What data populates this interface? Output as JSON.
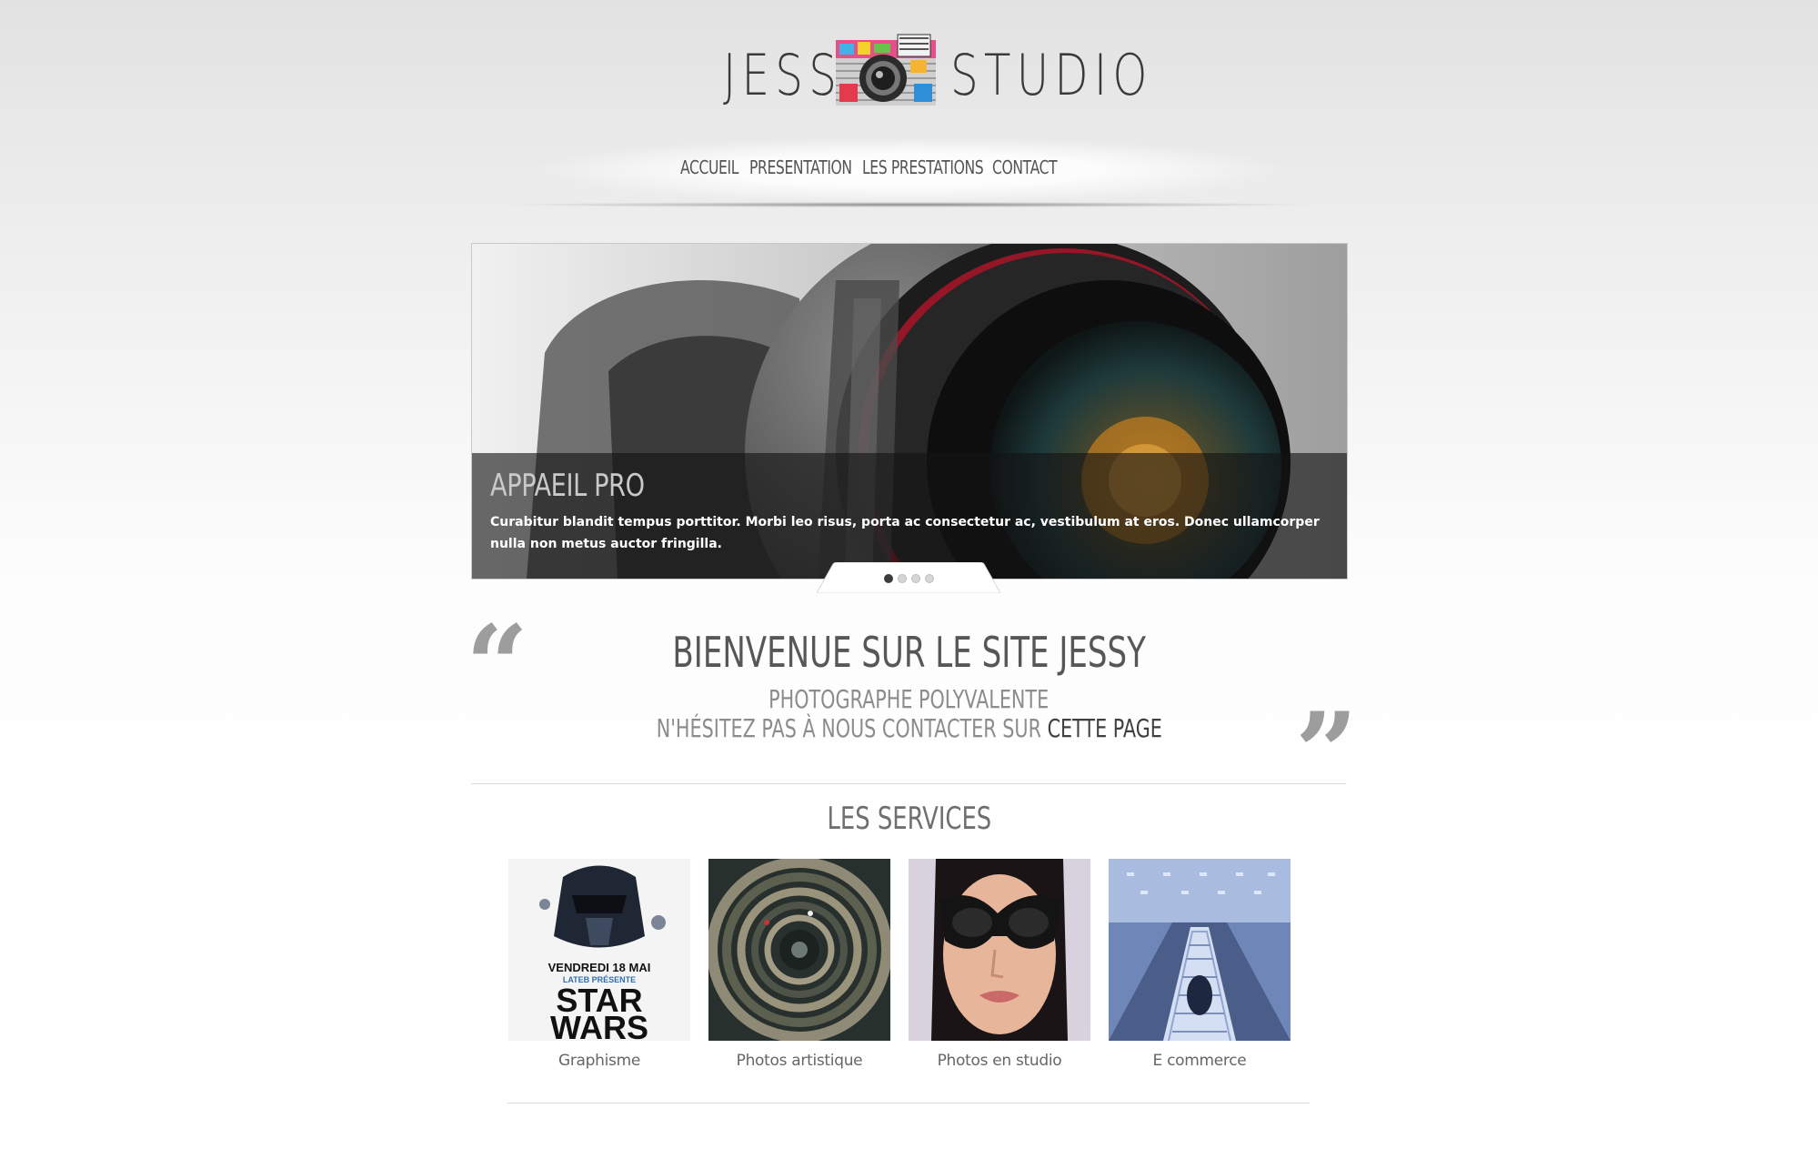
{
  "logo": {
    "left": "JESS",
    "right": "STUDIO",
    "icon": "retro-camera-icon"
  },
  "nav": {
    "items": [
      "ACCUEIL",
      "PRESENTATION",
      "LES PRESTATIONS",
      "CONTACT"
    ]
  },
  "slider": {
    "title": "APPAEIL PRO",
    "text": "Curabitur blandit tempus porttitor. Morbi leo risus, porta ac consectetur ac, vestibulum at eros. Donec ullamcorper nulla non metus auctor fringilla.",
    "slides_count": 4,
    "active_index": 0
  },
  "welcome": {
    "title": "BIENVENUE SUR LE SITE JESSY",
    "subtitle": "PHOTOGRAPHE POLYVALENTE",
    "contact_prefix": "N'HÉSITEZ PAS À NOUS CONTACTER SUR",
    "contact_link": "CETTE PAGE"
  },
  "services": {
    "title": "LES SERVICES",
    "items": [
      {
        "label": "Graphisme",
        "poster_line1": "VENDREDI 18 MAI",
        "poster_line2": "LATEB PRÉSENTE",
        "poster_line3": "STAR",
        "poster_line4": "WARS"
      },
      {
        "label": "Photos artistique"
      },
      {
        "label": "Photos en studio"
      },
      {
        "label": "E commerce"
      }
    ]
  },
  "colors": {
    "accent_text": "#3f3f3f",
    "muted_text": "#8c8c8c",
    "caption_bg": "#141414"
  }
}
